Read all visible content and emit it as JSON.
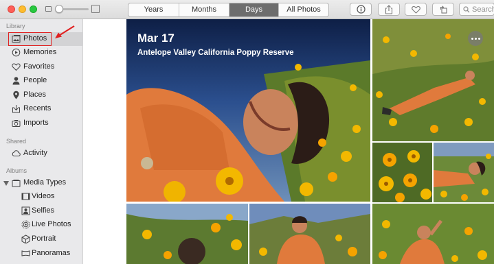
{
  "toolbar": {
    "tabs": [
      {
        "label": "Years",
        "active": false
      },
      {
        "label": "Months",
        "active": false
      },
      {
        "label": "Days",
        "active": true
      },
      {
        "label": "All Photos",
        "active": false
      }
    ],
    "buttons": [
      "info-icon",
      "share-icon",
      "heart-icon",
      "rotate-icon"
    ],
    "search": {
      "placeholder": "Search"
    }
  },
  "sidebar": {
    "sections": {
      "library": "Library",
      "shared": "Shared",
      "albums": "Albums"
    },
    "library_items": [
      {
        "label": "Photos",
        "icon": "photos-icon",
        "selected": true
      },
      {
        "label": "Memories",
        "icon": "memories-icon"
      },
      {
        "label": "Favorites",
        "icon": "heart-icon"
      },
      {
        "label": "People",
        "icon": "person-icon"
      },
      {
        "label": "Places",
        "icon": "pin-icon"
      },
      {
        "label": "Recents",
        "icon": "download-icon"
      },
      {
        "label": "Imports",
        "icon": "camera-icon"
      }
    ],
    "shared_items": [
      {
        "label": "Activity",
        "icon": "cloud-icon"
      }
    ],
    "album_items": [
      {
        "label": "Media Types",
        "icon": "stack-icon"
      },
      {
        "label": "Videos",
        "icon": "video-icon"
      },
      {
        "label": "Selfies",
        "icon": "selfie-icon"
      },
      {
        "label": "Live Photos",
        "icon": "live-icon"
      },
      {
        "label": "Portrait",
        "icon": "cube-icon"
      },
      {
        "label": "Panoramas",
        "icon": "panorama-icon"
      }
    ]
  },
  "hero": {
    "date": "Mar 17",
    "location": "Antelope Valley California Poppy Reserve"
  },
  "colors": {
    "accent_red": "#e02020",
    "active_tab": "#6d6d6d",
    "sidebar_bg": "#e9e9eb"
  }
}
